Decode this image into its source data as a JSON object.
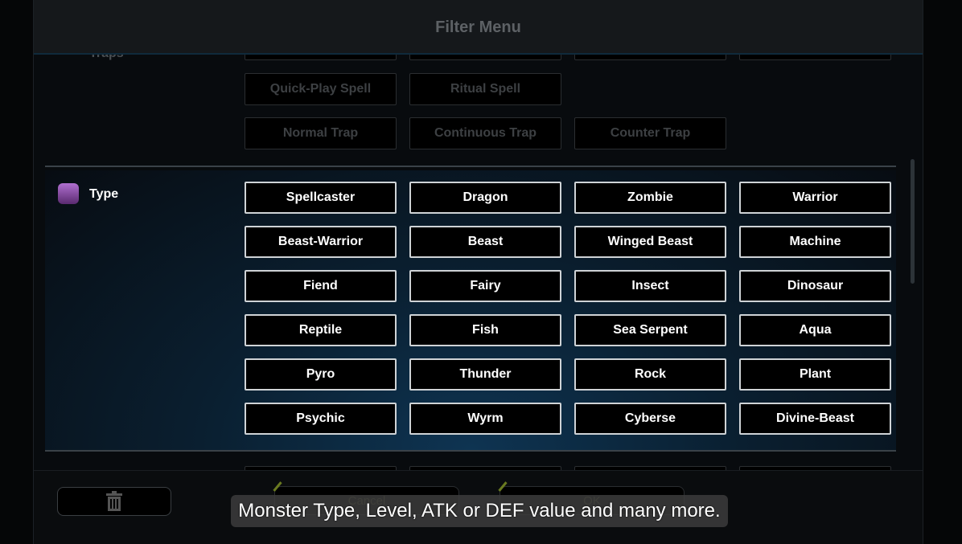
{
  "header": {
    "title": "Filter Menu"
  },
  "traps": {
    "label": "Traps",
    "rows": [
      [
        "",
        "",
        "",
        ""
      ],
      [
        "Quick-Play Spell",
        "Ritual Spell"
      ],
      [
        "Normal Trap",
        "Continuous Trap",
        "Counter Trap"
      ]
    ]
  },
  "type": {
    "label": "Type",
    "icon": "spellcaster-type-icon",
    "options": [
      [
        "Spellcaster",
        "Dragon",
        "Zombie",
        "Warrior"
      ],
      [
        "Beast-Warrior",
        "Beast",
        "Winged Beast",
        "Machine"
      ],
      [
        "Fiend",
        "Fairy",
        "Insect",
        "Dinosaur"
      ],
      [
        "Reptile",
        "Fish",
        "Sea Serpent",
        "Aqua"
      ],
      [
        "Pyro",
        "Thunder",
        "Rock",
        "Plant"
      ],
      [
        "Psychic",
        "Wyrm",
        "Cyberse",
        "Divine-Beast"
      ]
    ]
  },
  "footer": {
    "trash": "trash-icon",
    "cancel": "Cancel",
    "ok": "OK"
  },
  "subtitle": "Monster Type, Level, ATK or DEF value and many more."
}
